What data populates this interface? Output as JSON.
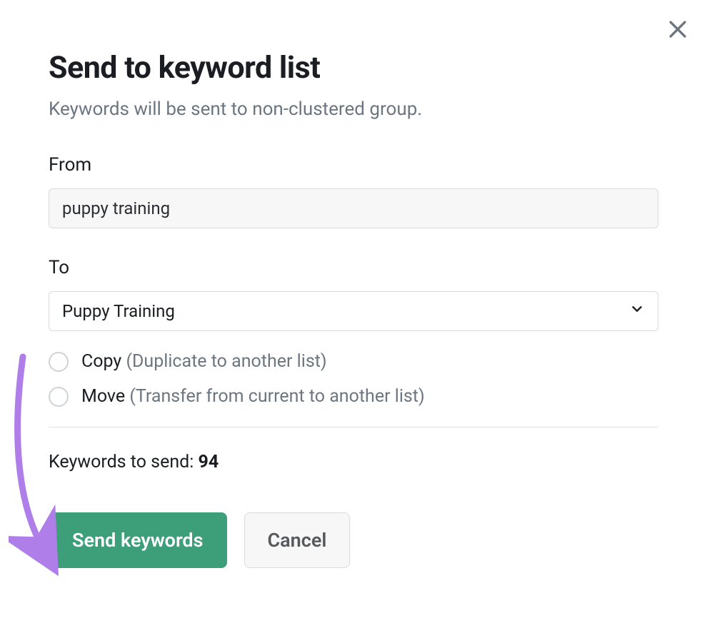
{
  "modal": {
    "title": "Send to keyword list",
    "subtitle": "Keywords will be sent to non-clustered group.",
    "from_label": "From",
    "from_value": "puppy training",
    "to_label": "To",
    "to_value": "Puppy Training",
    "options": {
      "copy_label": "Copy",
      "copy_hint": "(Duplicate to another list)",
      "move_label": "Move",
      "move_hint": "(Transfer from current to another list)"
    },
    "count_label": "Keywords to send: ",
    "count_value": "94",
    "send_label": "Send keywords",
    "cancel_label": "Cancel"
  }
}
